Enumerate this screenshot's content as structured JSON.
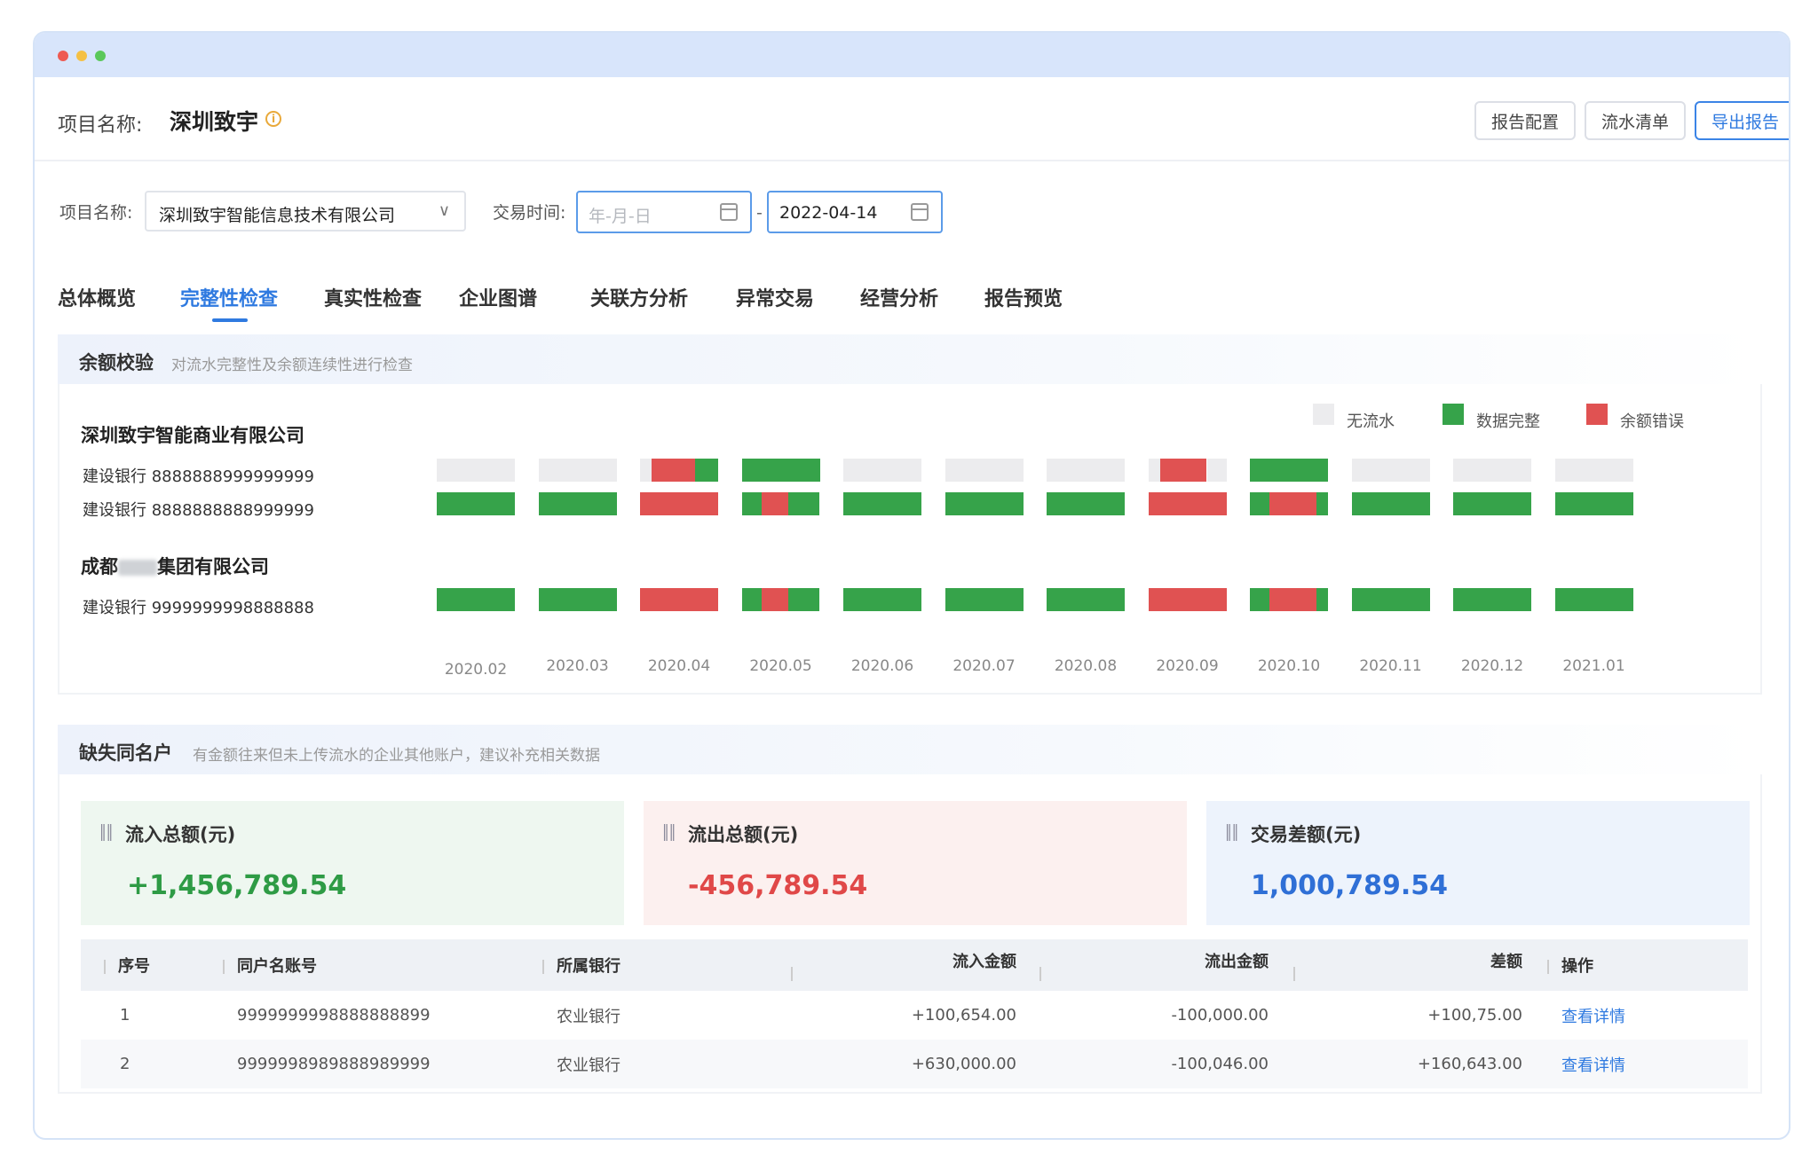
{
  "header": {
    "project_label": "项目名称:",
    "project_name": "深圳致宇",
    "buttons": {
      "report_config": "报告配置",
      "flow_list": "流水清单",
      "export_report": "导出报告"
    }
  },
  "filters": {
    "project_label": "项目名称:",
    "project_value": "深圳致宇智能信息技术有限公司",
    "time_label": "交易时间:",
    "start_placeholder": "年-月-日",
    "end_value": "2022-04-14"
  },
  "tabs": [
    "总体概览",
    "完整性检查",
    "真实性检查",
    "企业图谱",
    "关联方分析",
    "异常交易",
    "经营分析",
    "报告预览"
  ],
  "active_tab": "完整性检查",
  "balance_check": {
    "title": "余额校验",
    "desc": "对流水完整性及余额连续性进行检查",
    "legend": {
      "none": "无流水",
      "complete": "数据完整",
      "error": "余额错误"
    },
    "colors": {
      "none": "#ececee",
      "complete": "#36a34a",
      "error": "#e05252"
    },
    "company1": "深圳致宇智能商业有限公司",
    "company2_prefix": "成都",
    "company2_suffix": "集团有限公司",
    "accounts": [
      "建设银行 8888888999999999",
      "建设银行 8888888888999999",
      "建设银行 9999999998888888"
    ],
    "months": [
      "2020.02",
      "2020.03",
      "2020.04",
      "2020.05",
      "2020.06",
      "2020.07",
      "2020.08",
      "2020.09",
      "2020.10",
      "2020.11",
      "2020.12",
      "2021.01"
    ]
  },
  "missing_accounts": {
    "title": "缺失同名户",
    "desc": "有金额往来但未上传流水的企业其他账户，建议补充相关数据",
    "cards": {
      "inflow": {
        "label": "流入总额(元)",
        "value": "+1,456,789.54"
      },
      "outflow": {
        "label": "流出总额(元)",
        "value": "-456,789.54"
      },
      "diff": {
        "label": "交易差额(元)",
        "value": "1,000,789.54"
      }
    },
    "table": {
      "headers": [
        "序号",
        "同户名账号",
        "所属银行",
        "流入金额",
        "流出金额",
        "差额",
        "操作"
      ],
      "rows": [
        {
          "no": "1",
          "account": "9999999998888888899",
          "bank": "农业银行",
          "inflow": "+100,654.00",
          "outflow": "-100,000.00",
          "diff": "+100,75.00",
          "action": "查看详情"
        },
        {
          "no": "2",
          "account": "9999998989888989999",
          "bank": "农业银行",
          "inflow": "+630,000.00",
          "outflow": "-100,046.00",
          "diff": "+160,643.00",
          "action": "查看详情"
        }
      ]
    }
  }
}
